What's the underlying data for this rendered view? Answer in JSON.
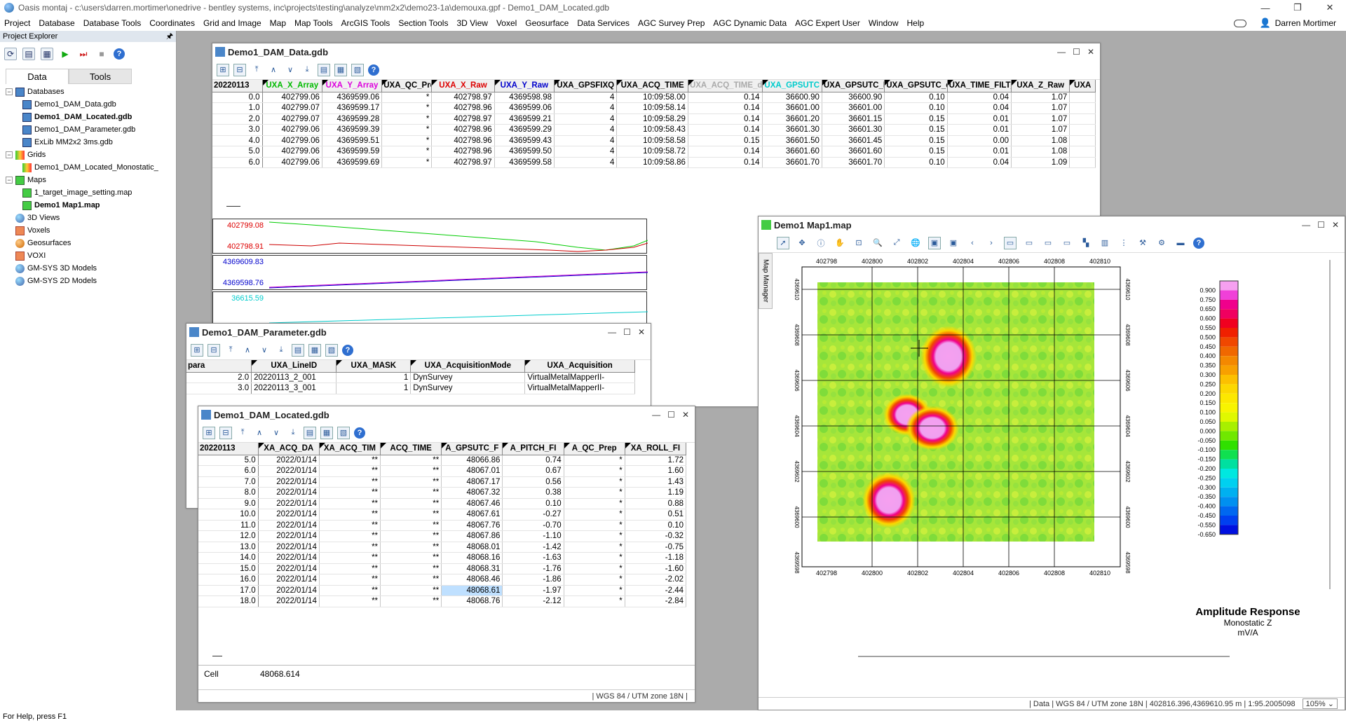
{
  "window": {
    "title": "Oasis montaj - c:\\users\\darren.mortimer\\onedrive - bentley systems, inc\\projects\\testing\\analyze\\mm2x2\\demo23-1a\\demouxa.gpf - Demo1_DAM_Located.gdb",
    "user": "Darren Mortimer"
  },
  "menu": [
    "Project",
    "Database",
    "Database Tools",
    "Coordinates",
    "Grid and Image",
    "Map",
    "Map Tools",
    "ArcGIS Tools",
    "Section Tools",
    "3D View",
    "Voxel",
    "Geosurface",
    "Data Services",
    "AGC Survey Prep",
    "AGC Dynamic Data",
    "AGC Expert User",
    "Window",
    "Help"
  ],
  "explorer": {
    "title": "Project Explorer",
    "tabs": [
      "Data",
      "Tools"
    ],
    "tree": [
      {
        "label": "Databases",
        "level": 0,
        "exp": "−",
        "icon": "db",
        "bold": false
      },
      {
        "label": "Demo1_DAM_Data.gdb",
        "level": 1,
        "icon": "db",
        "bold": false
      },
      {
        "label": "Demo1_DAM_Located.gdb",
        "level": 1,
        "icon": "db",
        "bold": true
      },
      {
        "label": "Demo1_DAM_Parameter.gdb",
        "level": 1,
        "icon": "db",
        "bold": false
      },
      {
        "label": "ExLib MM2x2 3ms.gdb",
        "level": 1,
        "icon": "db",
        "bold": false
      },
      {
        "label": "Grids",
        "level": 0,
        "exp": "−",
        "icon": "grid",
        "bold": false
      },
      {
        "label": "Demo1_DAM_Located_Monostatic_",
        "level": 1,
        "icon": "grid",
        "bold": false
      },
      {
        "label": "Maps",
        "level": 0,
        "exp": "−",
        "icon": "map",
        "bold": false
      },
      {
        "label": "1_target_image_setting.map",
        "level": 1,
        "icon": "map",
        "bold": false
      },
      {
        "label": "Demo1 Map1.map",
        "level": 1,
        "icon": "map",
        "bold": true
      },
      {
        "label": "3D Views",
        "level": 0,
        "icon": "ball",
        "bold": false
      },
      {
        "label": "Voxels",
        "level": 0,
        "icon": "vox",
        "bold": false
      },
      {
        "label": "Geosurfaces",
        "level": 0,
        "icon": "geo",
        "bold": false
      },
      {
        "label": "VOXI",
        "level": 0,
        "icon": "vox",
        "bold": false
      },
      {
        "label": "GM-SYS 3D Models",
        "level": 0,
        "icon": "ball",
        "bold": false
      },
      {
        "label": "GM-SYS 2D Models",
        "level": 0,
        "icon": "ball",
        "bold": false
      }
    ]
  },
  "status": "For Help, press F1",
  "data_win": {
    "title": "Demo1_DAM_Data.gdb",
    "headers": [
      {
        "t": "20220113",
        "c": "#000"
      },
      {
        "t": "UXA_X_Array",
        "c": "#0b0"
      },
      {
        "t": "UXA_Y_Array",
        "c": "#d0d"
      },
      {
        "t": "UXA_QC_Prep",
        "c": "#000"
      },
      {
        "t": "UXA_X_Raw",
        "c": "#d00"
      },
      {
        "t": "UXA_Y_Raw",
        "c": "#00c"
      },
      {
        "t": "UXA_GPSFIXQ",
        "c": "#000"
      },
      {
        "t": "UXA_ACQ_TIME",
        "c": "#000"
      },
      {
        "t": "UXA_ACQ_TIME_di",
        "c": "#aaa"
      },
      {
        "t": "UXA_GPSUTC",
        "c": "#0cc"
      },
      {
        "t": "UXA_GPSUTC_FII",
        "c": "#000"
      },
      {
        "t": "UXA_GPSUTC_di",
        "c": "#000"
      },
      {
        "t": "UXA_TIME_FILT_d",
        "c": "#000"
      },
      {
        "t": "UXA_Z_Raw",
        "c": "#000"
      },
      {
        "t": "UXA",
        "c": "#000"
      }
    ],
    "rows": [
      [
        "0.0",
        "402799.06",
        "4369599.06",
        "*",
        "402798.97",
        "4369598.98",
        "4",
        "10:09:58.00",
        "0.14",
        "36600.90",
        "36600.90",
        "0.10",
        "0.04",
        "1.07",
        ""
      ],
      [
        "1.0",
        "402799.07",
        "4369599.17",
        "*",
        "402798.96",
        "4369599.06",
        "4",
        "10:09:58.14",
        "0.14",
        "36601.00",
        "36601.00",
        "0.10",
        "0.04",
        "1.07",
        ""
      ],
      [
        "2.0",
        "402799.07",
        "4369599.28",
        "*",
        "402798.97",
        "4369599.21",
        "4",
        "10:09:58.29",
        "0.14",
        "36601.20",
        "36601.15",
        "0.15",
        "0.01",
        "1.07",
        ""
      ],
      [
        "3.0",
        "402799.06",
        "4369599.39",
        "*",
        "402798.96",
        "4369599.29",
        "4",
        "10:09:58.43",
        "0.14",
        "36601.30",
        "36601.30",
        "0.15",
        "0.01",
        "1.07",
        ""
      ],
      [
        "4.0",
        "402799.06",
        "4369599.51",
        "*",
        "402798.96",
        "4369599.43",
        "4",
        "10:09:58.58",
        "0.15",
        "36601.50",
        "36601.45",
        "0.15",
        "0.00",
        "1.08",
        ""
      ],
      [
        "5.0",
        "402799.06",
        "4369599.59",
        "*",
        "402798.96",
        "4369599.50",
        "4",
        "10:09:58.72",
        "0.14",
        "36601.60",
        "36601.60",
        "0.15",
        "0.01",
        "1.08",
        ""
      ],
      [
        "6.0",
        "402799.06",
        "4369599.69",
        "*",
        "402798.97",
        "4369599.58",
        "4",
        "10:09:58.86",
        "0.14",
        "36601.70",
        "36601.70",
        "0.10",
        "0.04",
        "1.09",
        ""
      ]
    ],
    "profile_labels": {
      "p1_top": "402799.08",
      "p1_bot": "402798.91",
      "p2_top": "4369609.83",
      "p2_bot": "4369598.76",
      "p3_top": "36615.59"
    }
  },
  "param_win": {
    "title": "Demo1_DAM_Parameter.gdb",
    "headers": [
      "para",
      "UXA_LineID",
      "UXA_MASK",
      "UXA_AcquisitionMode",
      "UXA_Acquisition"
    ],
    "rows": [
      [
        "2.0",
        "20220113_2_001",
        "1",
        "DynSurvey",
        "VirtualMetalMapperII-"
      ],
      [
        "3.0",
        "20220113_3_001",
        "1",
        "DynSurvey",
        "VirtualMetalMapperII-"
      ]
    ]
  },
  "located_win": {
    "title": "Demo1_DAM_Located.gdb",
    "headers": [
      "20220113",
      "XA_ACQ_DA",
      "XA_ACQ_TIM",
      "ACQ_TIME",
      "A_GPSUTC_F",
      "A_PITCH_FI",
      "A_QC_Prep",
      "XA_ROLL_FI"
    ],
    "rows": [
      [
        "5.0",
        "2022/01/14",
        "**",
        "**",
        "48066.86",
        "0.74",
        "*",
        "1.72"
      ],
      [
        "6.0",
        "2022/01/14",
        "**",
        "**",
        "48067.01",
        "0.67",
        "*",
        "1.60"
      ],
      [
        "7.0",
        "2022/01/14",
        "**",
        "**",
        "48067.17",
        "0.56",
        "*",
        "1.43"
      ],
      [
        "8.0",
        "2022/01/14",
        "**",
        "**",
        "48067.32",
        "0.38",
        "*",
        "1.19"
      ],
      [
        "9.0",
        "2022/01/14",
        "**",
        "**",
        "48067.46",
        "0.10",
        "*",
        "0.88"
      ],
      [
        "10.0",
        "2022/01/14",
        "**",
        "**",
        "48067.61",
        "-0.27",
        "*",
        "0.51"
      ],
      [
        "11.0",
        "2022/01/14",
        "**",
        "**",
        "48067.76",
        "-0.70",
        "*",
        "0.10"
      ],
      [
        "12.0",
        "2022/01/14",
        "**",
        "**",
        "48067.86",
        "-1.10",
        "*",
        "-0.32"
      ],
      [
        "13.0",
        "2022/01/14",
        "**",
        "**",
        "48068.01",
        "-1.42",
        "*",
        "-0.75"
      ],
      [
        "14.0",
        "2022/01/14",
        "**",
        "**",
        "48068.16",
        "-1.63",
        "*",
        "-1.18"
      ],
      [
        "15.0",
        "2022/01/14",
        "**",
        "**",
        "48068.31",
        "-1.76",
        "*",
        "-1.60"
      ],
      [
        "16.0",
        "2022/01/14",
        "**",
        "**",
        "48068.46",
        "-1.86",
        "*",
        "-2.02"
      ],
      [
        "17.0",
        "2022/01/14",
        "**",
        "**",
        "48068.61",
        "-1.97",
        "*",
        "-2.44"
      ],
      [
        "18.0",
        "2022/01/14",
        "**",
        "**",
        "48068.76",
        "-2.12",
        "*",
        "-2.84"
      ]
    ],
    "cell_label": "Cell",
    "cell_value": "48068.614",
    "status": "| WGS 84 / UTM zone 18N |"
  },
  "map_win": {
    "title": "Demo1 Map1.map",
    "side_tab": "Map Manager",
    "x_ticks": [
      "402798",
      "402800",
      "402802",
      "402804",
      "402806",
      "402808",
      "402810"
    ],
    "y_ticks": [
      "4369610",
      "4369608",
      "4369606",
      "4369604",
      "4369602",
      "4369600",
      "4369598"
    ],
    "legend_values": [
      "0.900",
      "0.750",
      "0.650",
      "0.600",
      "0.550",
      "0.500",
      "0.450",
      "0.400",
      "0.350",
      "0.300",
      "0.250",
      "0.200",
      "0.150",
      "0.100",
      "0.050",
      "0.000",
      "-0.050",
      "-0.100",
      "-0.150",
      "-0.200",
      "-0.250",
      "-0.300",
      "-0.350",
      "-0.400",
      "-0.450",
      "-0.550",
      "-0.650"
    ],
    "legend_colors": [
      "#f6a0f0",
      "#f040d8",
      "#f0008c",
      "#f00060",
      "#f00020",
      "#f02000",
      "#f04800",
      "#f06800",
      "#f48800",
      "#f8a000",
      "#fcc000",
      "#fcd800",
      "#fce800",
      "#f8f400",
      "#e0f800",
      "#a8f000",
      "#70e800",
      "#30e000",
      "#10e050",
      "#00e0a0",
      "#00e8e0",
      "#00d0f0",
      "#00b0f0",
      "#0090f0",
      "#0068f0",
      "#0040f0",
      "#0010e0"
    ],
    "legend_title": "Amplitude Response",
    "legend_sub1": "Monostatic Z",
    "legend_sub2": "mV/A",
    "status": "| Data | WGS 84 / UTM zone 18N | 402816.396,4369610.95 m | 1:95.2005098",
    "zoom": "105%"
  }
}
